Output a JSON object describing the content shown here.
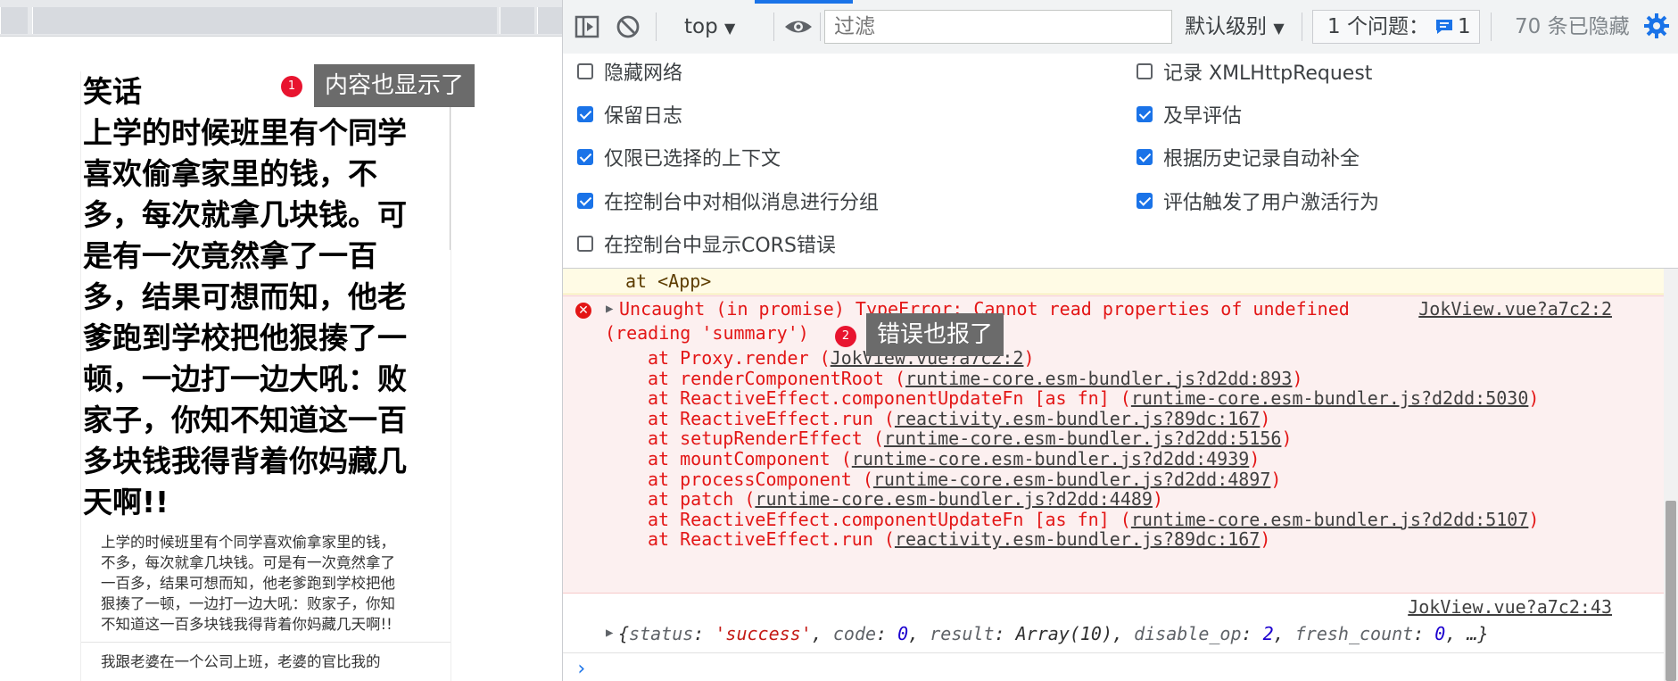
{
  "left": {
    "joke_title": "笑话",
    "joke_headline_lines": [
      "上学的时候班里有个同学",
      "喜欢偷拿家里的钱，不",
      "多，每次就拿几块钱。可",
      "是有一次竟然拿了一百",
      "多，结果可想而知，他老",
      "爹跑到学校把他狠揍了一",
      "顿，一边打一边大吼：败",
      "家子，你知不知道这一百",
      "多块钱我得背着你妈藏几",
      "天啊!!"
    ],
    "joke_body_lines": [
      "上学的时候班里有个同学喜欢偷拿家里的钱，",
      "不多，每次就拿几块钱。可是有一次竟然拿了",
      "一百多，结果可想而知，他老爹跑到学校把他",
      "狠揍了一顿，一边打一边大吼：败家子，你知",
      "不知道这一百多块钱我得背着你妈藏几天啊!!"
    ],
    "next_joke_line": "我跟老婆在一个公司上班，老婆的官比我的"
  },
  "annotations": {
    "a1_num": "1",
    "a1_text": "内容也显示了",
    "a2_num": "2",
    "a2_text": "错误也报了"
  },
  "toolbar": {
    "context": "top",
    "filter_placeholder": "过滤",
    "level": "默认级别",
    "issues_label": "1 个问题：",
    "issues_count": "1",
    "hidden": "70 条已隐藏"
  },
  "settings": {
    "left": [
      {
        "label": "隐藏网络",
        "checked": false
      },
      {
        "label": "保留日志",
        "checked": true
      },
      {
        "label": "仅限已选择的上下文",
        "checked": true
      },
      {
        "label": "在控制台中对相似消息进行分组",
        "checked": true
      },
      {
        "label": "在控制台中显示CORS错误",
        "checked": false
      }
    ],
    "right": [
      {
        "label": "记录 XMLHttpRequest",
        "checked": false
      },
      {
        "label": "及早评估",
        "checked": true
      },
      {
        "label": "根据历史记录自动补全",
        "checked": true
      },
      {
        "label": "评估触发了用户激活行为",
        "checked": true
      }
    ]
  },
  "console": {
    "warn_tail": "at <App>",
    "error": {
      "line1": "Uncaught (in promise) TypeError: Cannot read properties of undefined",
      "line2": "(reading 'summary')",
      "source": "JokView.vue?a7c2:2",
      "stack": [
        {
          "prefix": "at Proxy.render (",
          "link": "JokView.vue?a7c2:2",
          "suffix": ")"
        },
        {
          "prefix": "at renderComponentRoot (",
          "link": "runtime-core.esm-bundler.js?d2dd:893",
          "suffix": ")"
        },
        {
          "prefix": "at ReactiveEffect.componentUpdateFn [as fn] (",
          "link": "runtime-core.esm-bundler.js?d2dd:5030",
          "suffix": ")"
        },
        {
          "prefix": "at ReactiveEffect.run (",
          "link": "reactivity.esm-bundler.js?89dc:167",
          "suffix": ")"
        },
        {
          "prefix": "at setupRenderEffect (",
          "link": "runtime-core.esm-bundler.js?d2dd:5156",
          "suffix": ")"
        },
        {
          "prefix": "at mountComponent (",
          "link": "runtime-core.esm-bundler.js?d2dd:4939",
          "suffix": ")"
        },
        {
          "prefix": "at processComponent (",
          "link": "runtime-core.esm-bundler.js?d2dd:4897",
          "suffix": ")"
        },
        {
          "prefix": "at patch (",
          "link": "runtime-core.esm-bundler.js?d2dd:4489",
          "suffix": ")"
        },
        {
          "prefix": "at ReactiveEffect.componentUpdateFn [as fn] (",
          "link": "runtime-core.esm-bundler.js?d2dd:5107",
          "suffix": ")"
        },
        {
          "prefix": "at ReactiveEffect.run (",
          "link": "reactivity.esm-bundler.js?89dc:167",
          "suffix": ")"
        }
      ]
    },
    "log": {
      "source": "JokView.vue?a7c2:43",
      "status_key": "status",
      "status_val": "'success'",
      "code_key": "code",
      "code_val": "0",
      "result_key": "result",
      "result_val": "Array(10)",
      "disable_key": "disable_op",
      "disable_val": "2",
      "fresh_key": "fresh_count",
      "fresh_val": "0",
      "ellipsis": "…"
    },
    "prompt": "›"
  }
}
